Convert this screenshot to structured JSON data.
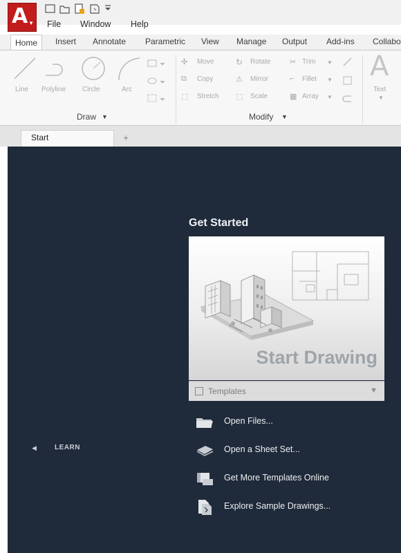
{
  "app": {
    "logo_letter": "A"
  },
  "menu": [
    "File",
    "Window",
    "Help"
  ],
  "ribbon_tabs": [
    "Home",
    "Insert",
    "Annotate",
    "Parametric",
    "View",
    "Manage",
    "Output",
    "Add-ins",
    "Collabo"
  ],
  "draw_panel": {
    "title": "Draw",
    "tools": [
      "Line",
      "Polyline",
      "Circle",
      "Arc"
    ]
  },
  "modify_panel": {
    "title": "Modify",
    "tools": [
      "Move",
      "Rotate",
      "Trim",
      "Copy",
      "Mirror",
      "Fillet",
      "Stretch",
      "Scale",
      "Array"
    ]
  },
  "annotation_panel": {
    "tools": [
      "Text"
    ]
  },
  "doc_tabs": {
    "start": "Start",
    "add": "+"
  },
  "start_page": {
    "heading": "Get Started",
    "card_label": "Start Drawing",
    "templates_label": "Templates",
    "links": [
      "Open Files...",
      "Open a Sheet Set...",
      "Get More Templates Online",
      "Explore Sample Drawings..."
    ],
    "learn_label": "LEARN"
  },
  "colors": {
    "app_red": "#c21c1c",
    "start_bg": "#1f2a3a",
    "ribbon_bg": "#f7f7f7"
  }
}
